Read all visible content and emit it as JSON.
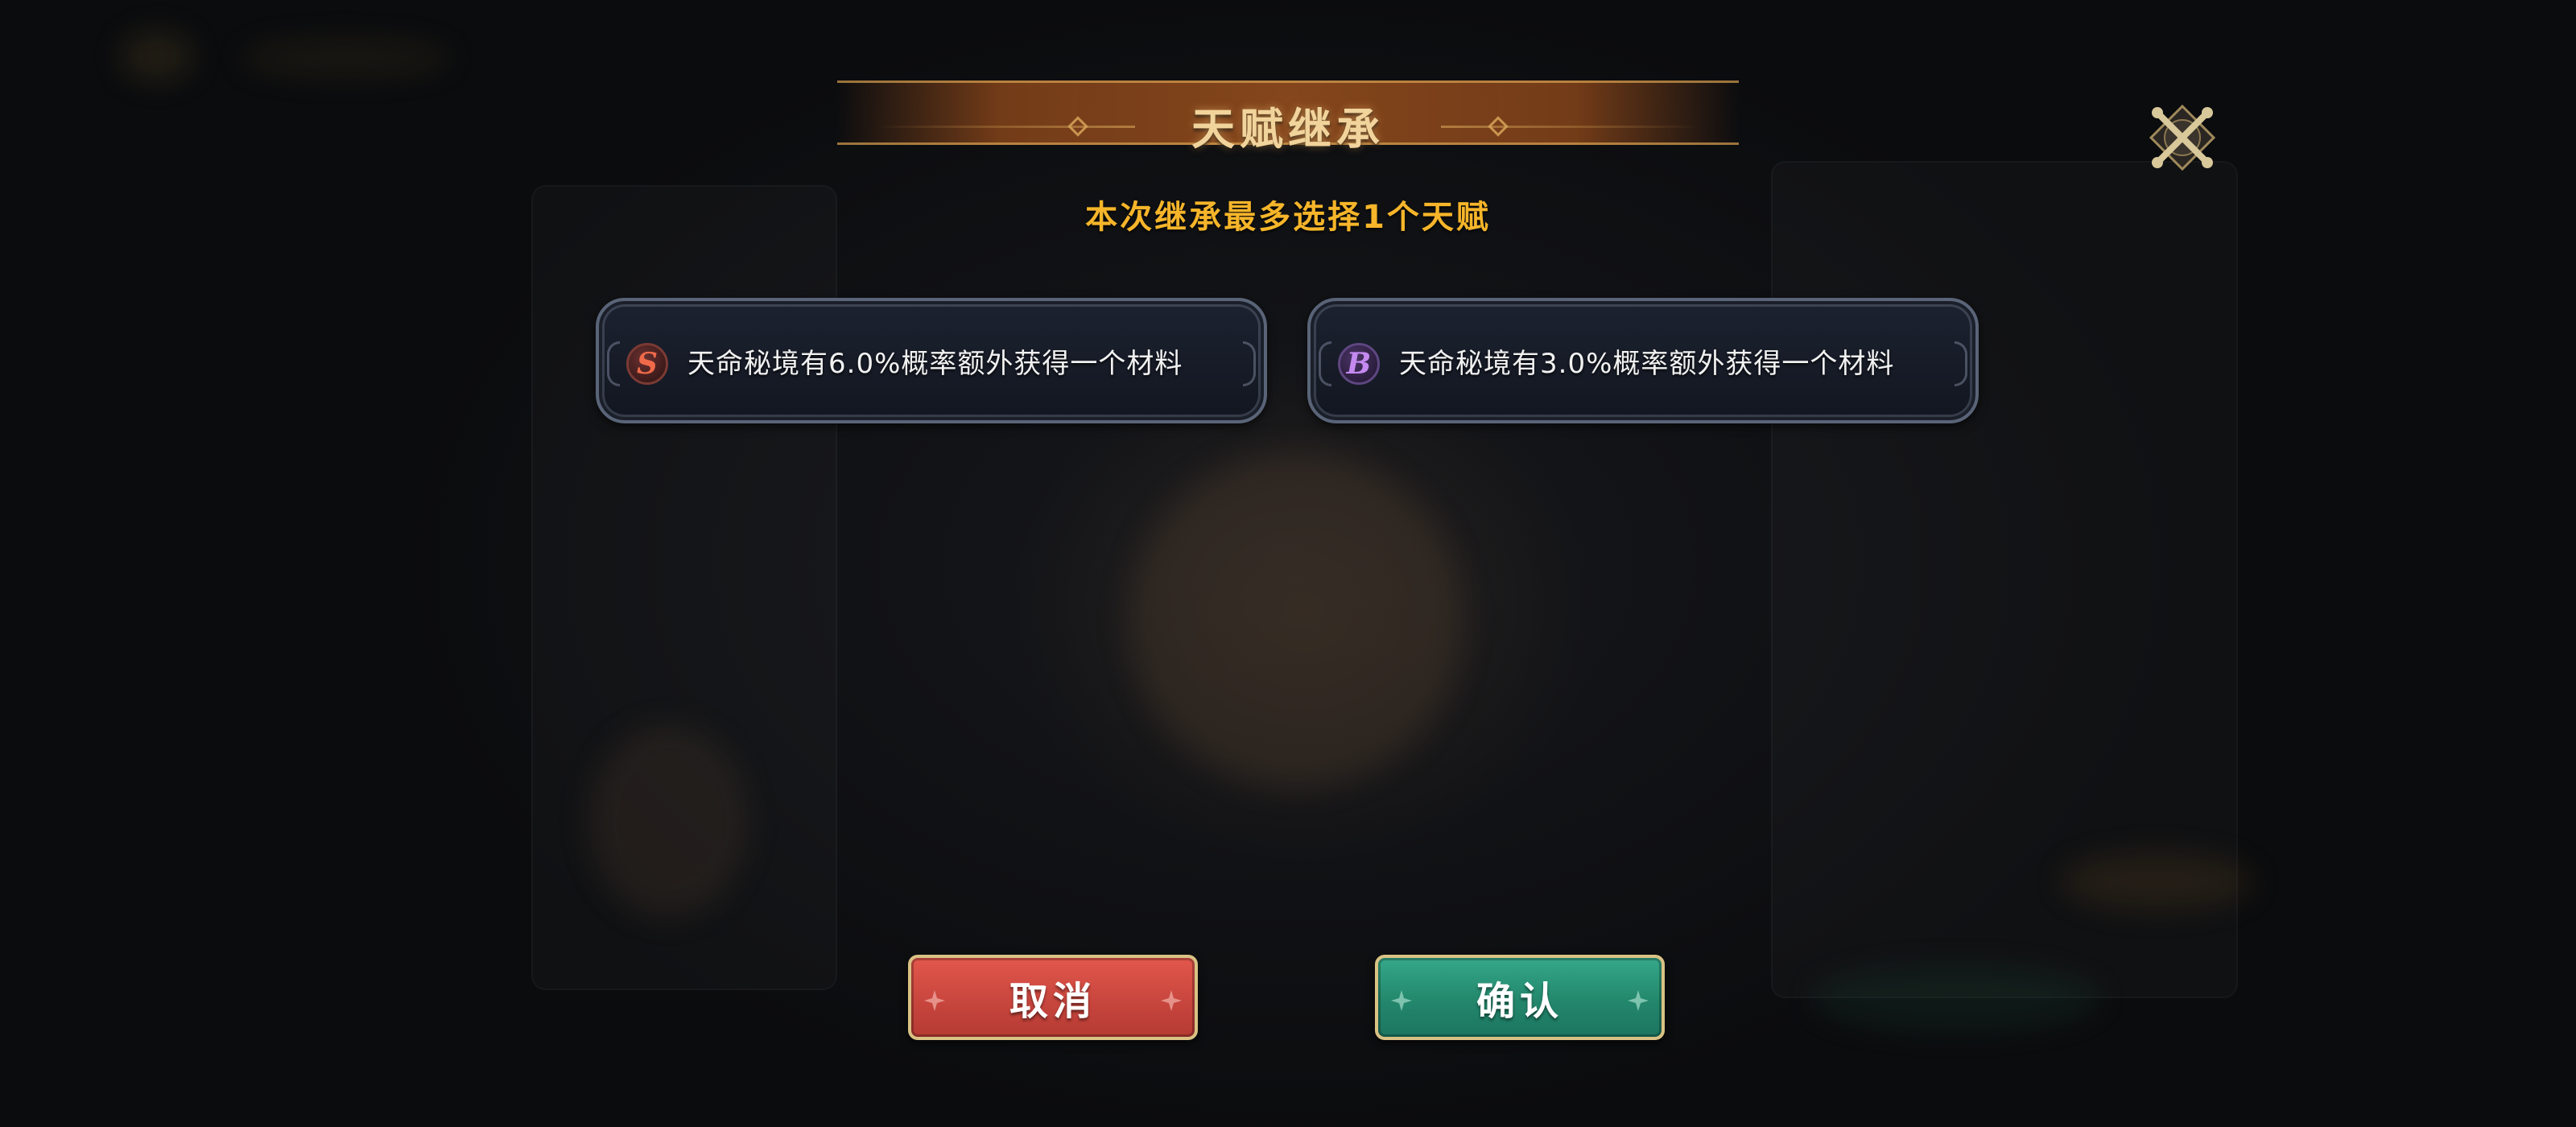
{
  "dialog": {
    "title": "天赋继承",
    "subtitle": "本次继承最多选择1个天赋",
    "close_icon": "close-x-icon"
  },
  "talents": [
    {
      "rank": "S",
      "rank_color": "#f06a4a",
      "description": "天命秘境有6.0%概率额外获得一个材料"
    },
    {
      "rank": "B",
      "rank_color": "#c48af0",
      "description": "天命秘境有3.0%概率额外获得一个材料"
    }
  ],
  "buttons": {
    "cancel_label": "取消",
    "cancel_color": "#d24c43",
    "confirm_label": "确认",
    "confirm_color": "#27907a"
  },
  "colors": {
    "title_gold": "#f1d49c",
    "subtitle_orange": "#f6b52a",
    "button_border_gold": "#d9c284"
  }
}
